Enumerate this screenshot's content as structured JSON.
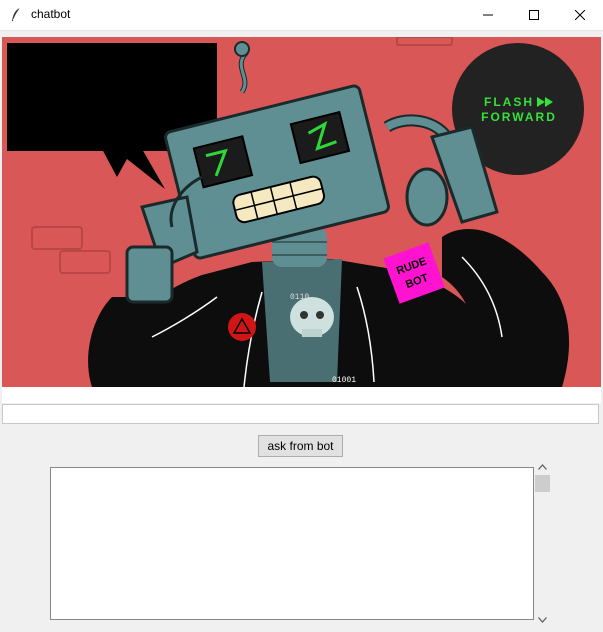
{
  "window": {
    "title": "chatbot",
    "controls": {
      "minimize": "minimize-icon",
      "maximize": "maximize-icon",
      "close": "close-icon"
    }
  },
  "image": {
    "logo_line1": "FLASH",
    "logo_line2": "FORWARD",
    "patch_line1": "RUDE",
    "patch_line2": "BOT",
    "binary1": "0110",
    "binary2": "01001",
    "colors": {
      "background": "#d95757",
      "robot": "#5f8f93",
      "jacket": "#0d0d0d",
      "logo_circle": "#222222",
      "logo_text": "#35e03a",
      "patch": "#ff12d0",
      "eyes": "#2ed73a"
    }
  },
  "input": {
    "value": "",
    "placeholder": ""
  },
  "ask_button": {
    "label": "ask from bot"
  },
  "response": {
    "text": ""
  }
}
